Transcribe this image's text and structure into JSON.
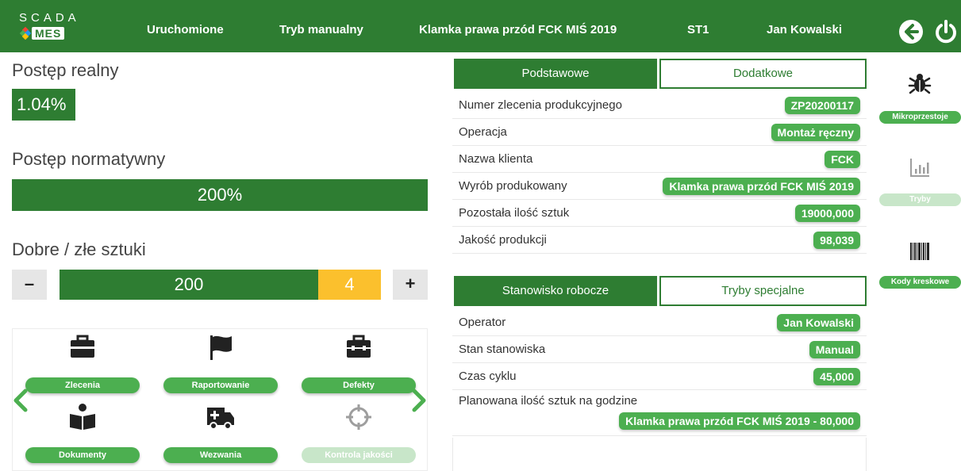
{
  "header": {
    "logo_top": "SCADA",
    "logo_bottom": "MES",
    "status": "Uruchomione",
    "mode": "Tryb manualny",
    "product": "Klamka prawa przód FCK MIŚ 2019",
    "station": "ST1",
    "user": "Jan Kowalski",
    "back_icon": "back-arrow-icon",
    "power_icon": "power-icon"
  },
  "progress": {
    "real_label": "Postęp realny",
    "real_value": "1.04%",
    "norm_label": "Postęp normatywny",
    "norm_value": "200%",
    "pieces_label": "Dobre / złe sztuki",
    "good": "200",
    "bad": "4",
    "minus": "–",
    "plus": "+"
  },
  "tiles": [
    {
      "label": "Zlecenia",
      "icon": "briefcase-icon"
    },
    {
      "label": "Raportowanie",
      "icon": "flag-icon"
    },
    {
      "label": "Defekty",
      "icon": "toolbox-icon"
    },
    {
      "label": "Dokumenty",
      "icon": "book-reader-icon"
    },
    {
      "label": "Wezwania",
      "icon": "ambulance-icon"
    },
    {
      "label": "Kontrola jakości",
      "icon": "crosshair-icon"
    }
  ],
  "order_panel": {
    "tab_basic": "Podstawowe",
    "tab_extra": "Dodatkowe",
    "rows": [
      {
        "label": "Numer zlecenia produkcyjnego",
        "value": "ZP20200117"
      },
      {
        "label": "Operacja",
        "value": "Montaż ręczny"
      },
      {
        "label": "Nazwa klienta",
        "value": "FCK"
      },
      {
        "label": "Wyrób produkowany",
        "value": "Klamka prawa przód FCK MIŚ 2019"
      },
      {
        "label": "Pozostała ilość sztuk",
        "value": "19000,000"
      },
      {
        "label": "Jakość produkcji",
        "value": "98,039"
      }
    ]
  },
  "station_panel": {
    "tab_station": "Stanowisko robocze",
    "tab_special": "Tryby specjalne",
    "rows": [
      {
        "label": "Operator",
        "value": "Jan Kowalski"
      },
      {
        "label": "Stan stanowiska",
        "value": "Manual"
      },
      {
        "label": "Czas cyklu",
        "value": "45,000"
      },
      {
        "label": "Planowana ilość sztuk na godzine",
        "value": "Klamka prawa przód FCK MIŚ 2019 - 80,000"
      }
    ]
  },
  "side_actions": [
    {
      "label": "Mikroprzestoje",
      "icon": "bug-icon"
    },
    {
      "label": "Tryby",
      "icon": "bar-chart-icon"
    },
    {
      "label": "Kody kreskowe",
      "icon": "barcode-icon"
    }
  ],
  "colors": {
    "primary": "#2e7d32",
    "accent": "#4caf50",
    "warning": "#fbc02d"
  }
}
